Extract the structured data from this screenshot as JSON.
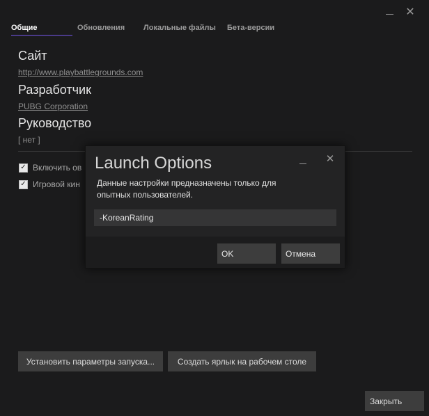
{
  "window": {
    "minimize_icon": "minimize-icon",
    "close_icon": "close-icon",
    "close_glyph": "✕"
  },
  "tabs": [
    {
      "label": "Общие"
    },
    {
      "label": "Обновления"
    },
    {
      "label": "Локальные файлы"
    },
    {
      "label": "Бета-версии"
    }
  ],
  "general": {
    "site_heading": "Сайт",
    "site_link": "http://www.playbattlegrounds.com",
    "developer_heading": "Разработчик",
    "developer_link": "PUBG Corporation",
    "guide_heading": "Руководство",
    "guide_value": "[ нет ]",
    "checkbox_1_label": "Включить ов",
    "checkbox_2_label": "Игровой кин",
    "launch_options_button": "Установить параметры запуска...",
    "desktop_shortcut_button": "Создать ярлык на рабочем столе",
    "close_button": "Закрыть"
  },
  "dialog": {
    "title": "Launch Options",
    "description": "Данные настройки предназначены только для опытных пользователей.",
    "input_value": "-KoreanRating",
    "ok_label": "OK",
    "cancel_label": "Отмена"
  },
  "colors": {
    "background": "#1b1b1c",
    "tab_accent": "#4a3a88",
    "button": "#3d3d3d",
    "dialog_bg": "#232324"
  }
}
